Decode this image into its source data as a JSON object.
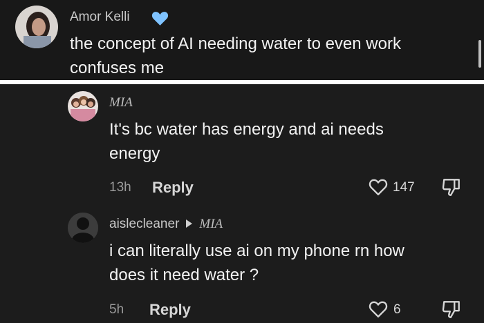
{
  "comment_main": {
    "author": "Amor Kelli",
    "author_badge_icon": "blue-heart-icon",
    "badge_color": "#7fc3ff",
    "text_line1": "the concept of AI needing water to even work",
    "text_line2": "confuses me"
  },
  "reply_1": {
    "author": "MIA",
    "text_line1": "It's bc water has energy and ai needs",
    "text_line2": "energy",
    "time": "13h",
    "reply_label": "Reply",
    "likes": "147",
    "like_icon": "heart-outline-icon",
    "dislike_icon": "thumbs-down-icon"
  },
  "reply_2": {
    "author": "aislecleaner",
    "reply_to": "MIA",
    "text_line1": "i can literally use ai on my phone rn how",
    "text_line2": "does it need water ?",
    "time": "5h",
    "reply_label": "Reply",
    "likes": "6",
    "like_icon": "heart-outline-icon",
    "dislike_icon": "thumbs-down-icon"
  }
}
